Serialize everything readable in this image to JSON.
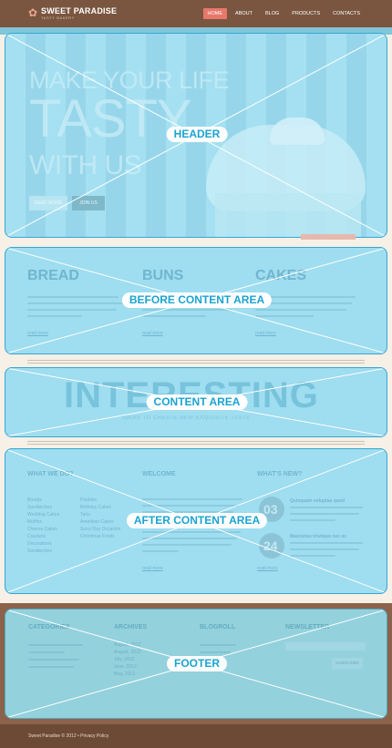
{
  "site": {
    "title": "SWEET PARADISE",
    "subtitle": "TASTY BAKERY"
  },
  "nav": {
    "items": [
      "HOME",
      "ABOUT",
      "BLOG",
      "PRODUCTS",
      "CONTACTS"
    ],
    "active": "HOME"
  },
  "header": {
    "label": "HEADER",
    "hero_line1": "MAKE YOUR LIFE",
    "hero_line2": "TASTY",
    "hero_line3": "WITH US",
    "button_read": "READ MORE",
    "button_join": "JOIN US"
  },
  "before_content": {
    "label": "BEFORE CONTENT AREA",
    "columns": [
      {
        "title": "BREAD",
        "link": "read more"
      },
      {
        "title": "BUNS",
        "link": "read more"
      },
      {
        "title": "CAKES",
        "link": "read more"
      }
    ]
  },
  "content": {
    "label": "CONTENT AREA",
    "heading": "INTERESTING",
    "subheading": "IDEAS TO CREATE NEW EXQUISITE TASTE"
  },
  "after_content": {
    "label": "AFTER CONTENT AREA",
    "col1_title": "WHAT WE DO?",
    "col1_items_left": [
      "Breads",
      "Sandwiches",
      "Wedding Cakes",
      "Muffins",
      "Cheese Cakes",
      "Crackers",
      "Decorations",
      "Sandwiches"
    ],
    "col1_items_right": [
      "Pastries",
      "Birthday Cakes",
      "Tarts",
      "Amerikan Cakes",
      "Sorry Day Occasion",
      "Christmas Foods"
    ],
    "col2_title": "WELCOME",
    "col2_link": "read more",
    "col3_title": "WHAT'S NEW?",
    "news": [
      {
        "day": "03",
        "title": "Quisquam voluptas quod"
      },
      {
        "day": "24",
        "title": "Maecenas tristique nec ac"
      }
    ],
    "col3_link": "read more"
  },
  "footer": {
    "label": "FOOTER",
    "columns": [
      "CATEGORIES",
      "ARCHIVES",
      "BLOGROLL",
      "NEWSLETTER"
    ],
    "archives": [
      "August, 2012",
      "August, 2012",
      "July, 2012",
      "June, 2012",
      "May, 2012"
    ],
    "newsletter_button": "SUBSCRIBE",
    "copyright": "Sweet Paradise © 2012 • Privacy Policy"
  },
  "colors": {
    "accent": "#1aa3d2",
    "wire_fill": "#9fddf0",
    "brown": "#7a5640",
    "nav_active": "#e7786a"
  }
}
